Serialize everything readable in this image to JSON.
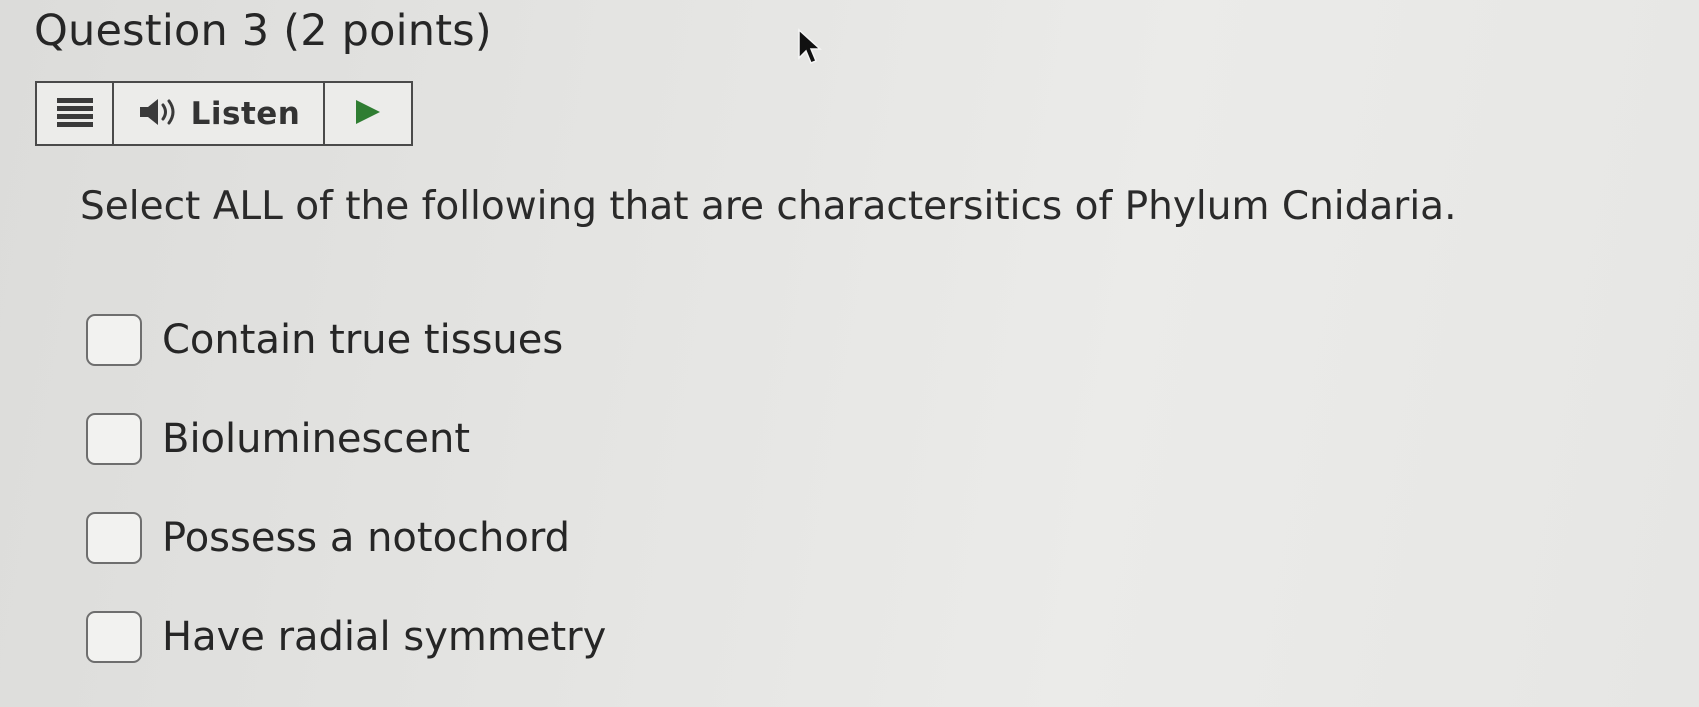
{
  "question": {
    "title": "Question 3 (2 points)",
    "prompt": "Select ALL of the following that are charactersitics of Phylum Cnidaria."
  },
  "toolbar": {
    "menu_icon": "hamburger-menu-icon",
    "speaker_icon": "speaker-icon",
    "listen_label": "Listen",
    "play_icon": "play-icon",
    "play_color": "#2f7d32"
  },
  "options": [
    {
      "label": "Contain true tissues",
      "checked": false
    },
    {
      "label": "Bioluminescent",
      "checked": false
    },
    {
      "label": "Possess a notochord",
      "checked": false
    },
    {
      "label": "Have radial symmetry",
      "checked": false
    }
  ]
}
